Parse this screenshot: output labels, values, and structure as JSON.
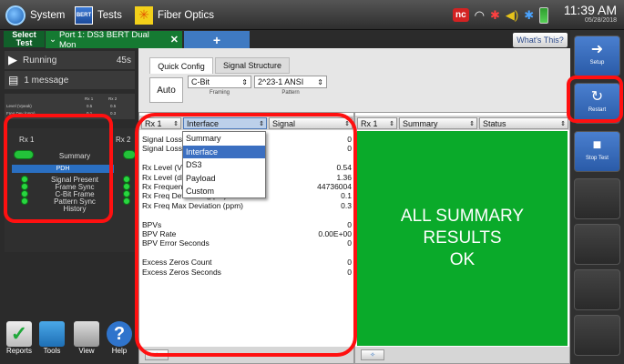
{
  "topbar": {
    "system_label": "System",
    "tests_label": "Tests",
    "tests_icon_text": "BERT",
    "fiber_label": "Fiber Optics",
    "nc_label": "nc",
    "clock_time": "11:39 AM",
    "clock_date": "05/28/2018"
  },
  "tabbar": {
    "select_test": "Select Test",
    "port_tab": "Port 1: DS3 BERT Dual Mon",
    "plus_label": "+",
    "whats_this": "What's This?"
  },
  "rightbar": {
    "setup": "Setup",
    "restart": "Restart",
    "stop_test": "Stop Test"
  },
  "left": {
    "status": "Running",
    "elapsed": "45s",
    "messages": "1 message",
    "rx1": "Rx 1",
    "rx2": "Rx 2",
    "level_label": "Level (Vpeak)",
    "level_rx1": "0.5",
    "level_rx2": "0.5",
    "freq_label": "Freq Dev (ppm)",
    "freq_rx1": "0.1",
    "freq_rx2": "0.3",
    "summary": "Summary",
    "pdh": "PDH",
    "indicators": [
      "Signal Present",
      "Frame Sync",
      "C-Bit Frame",
      "Pattern Sync",
      "History"
    ],
    "bottom": [
      "Reports",
      "Tools",
      "View",
      "Help"
    ]
  },
  "config": {
    "tabs": [
      "Quick Config",
      "Signal Structure"
    ],
    "auto": "Auto",
    "framing_value": "C-Bit",
    "framing_label": "Framing",
    "pattern_value": "2^23-1 ANSI",
    "pattern_label": "Pattern"
  },
  "left_panel": {
    "rx": "Rx 1",
    "category": "Interface",
    "group": "Signal",
    "dropdown_options": [
      "Summary",
      "Interface",
      "DS3",
      "Payload",
      "Custom"
    ],
    "dropdown_selected": "Interface",
    "rows": [
      {
        "label": "Signal Loss Count",
        "value": "0"
      },
      {
        "label": "Signal Loss Seconds",
        "value": "0"
      },
      {
        "label": "",
        "value": ""
      },
      {
        "label": "Rx Level (Vpeak)",
        "value": "0.54"
      },
      {
        "label": "Rx Level (dBdsx)",
        "value": "1.36"
      },
      {
        "label": "Rx Frequency (Hz)",
        "value": "44736004"
      },
      {
        "label": "Rx Freq Deviation (ppm)",
        "value": "0.1"
      },
      {
        "label": "Rx Freq Max Deviation (ppm)",
        "value": "0.3"
      },
      {
        "label": "",
        "value": ""
      },
      {
        "label": "BPVs",
        "value": "0"
      },
      {
        "label": "BPV Rate",
        "value": "0.00E+00"
      },
      {
        "label": "BPV Error Seconds",
        "value": "0"
      },
      {
        "label": "",
        "value": ""
      },
      {
        "label": "Excess Zeros Count",
        "value": "0"
      },
      {
        "label": "Excess Zeros Seconds",
        "value": "0"
      }
    ],
    "scroll_icon": "✧"
  },
  "right_panel": {
    "rx": "Rx 1",
    "category": "Summary",
    "group": "Status",
    "message_lines": [
      "ALL SUMMARY",
      "RESULTS",
      "OK"
    ],
    "scroll_icon": "✧"
  },
  "colors": {
    "ok_green": "#0aaa2a",
    "annotation_red": "#ff1010",
    "led_green": "#29d640",
    "accent_blue": "#2a6fc2"
  }
}
